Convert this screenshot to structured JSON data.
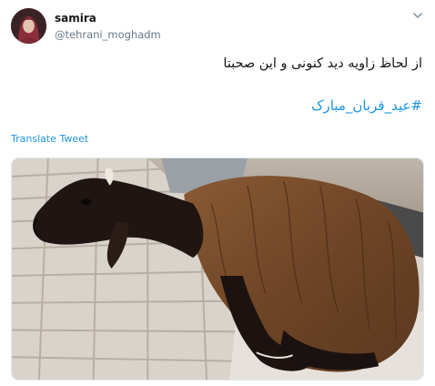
{
  "author": {
    "name": "samira",
    "handle": "@tehrani_moghadm",
    "avatar": "avatar-photo"
  },
  "tweet": {
    "text": "از لحاظ زاویه دید کنونی و این صحبتا",
    "hashtag": "#عید_قربان_مبارک",
    "translate_label": "Translate Tweet"
  },
  "media": {
    "description_icon": "photo-sheep"
  },
  "icons": {
    "menu": "chevron-down-icon"
  },
  "colors": {
    "link": "#1b95e0",
    "secondary_text": "#657786",
    "primary_text": "#14171a"
  }
}
